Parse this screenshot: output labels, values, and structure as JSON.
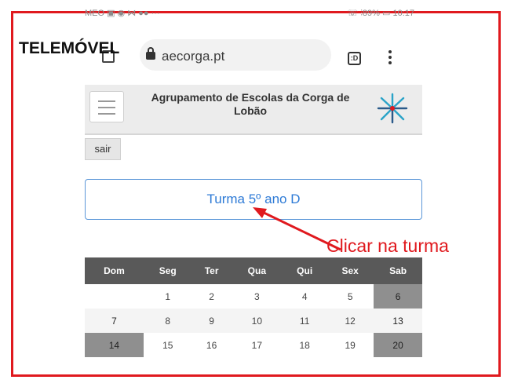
{
  "annotation": {
    "device_label": "TELEMÓVEL",
    "callout_text": "Clicar na turma",
    "accent_color": "#e0191e"
  },
  "status_bar": {
    "left": "MEO ▣ ◉ ⋈ ●● ···",
    "right": "☏ ⫶89% ▭ 10:17"
  },
  "browser": {
    "url": "aecorga.pt",
    "tab_count": ":D"
  },
  "site": {
    "title": "Agrupamento de Escolas da Corga de Lobão",
    "logout_label": "sair",
    "class_button": "Turma 5º ano D"
  },
  "calendar": {
    "headers": [
      "Dom",
      "Seg",
      "Ter",
      "Qua",
      "Qui",
      "Sex",
      "Sab"
    ],
    "rows": [
      [
        "",
        "1",
        "2",
        "3",
        "4",
        "5",
        "6"
      ],
      [
        "7",
        "8",
        "9",
        "10",
        "11",
        "12",
        "13"
      ],
      [
        "14",
        "15",
        "16",
        "17",
        "18",
        "19",
        "20"
      ]
    ],
    "header_bg": "#595959",
    "weekend_bg": "#8f8f8f"
  }
}
